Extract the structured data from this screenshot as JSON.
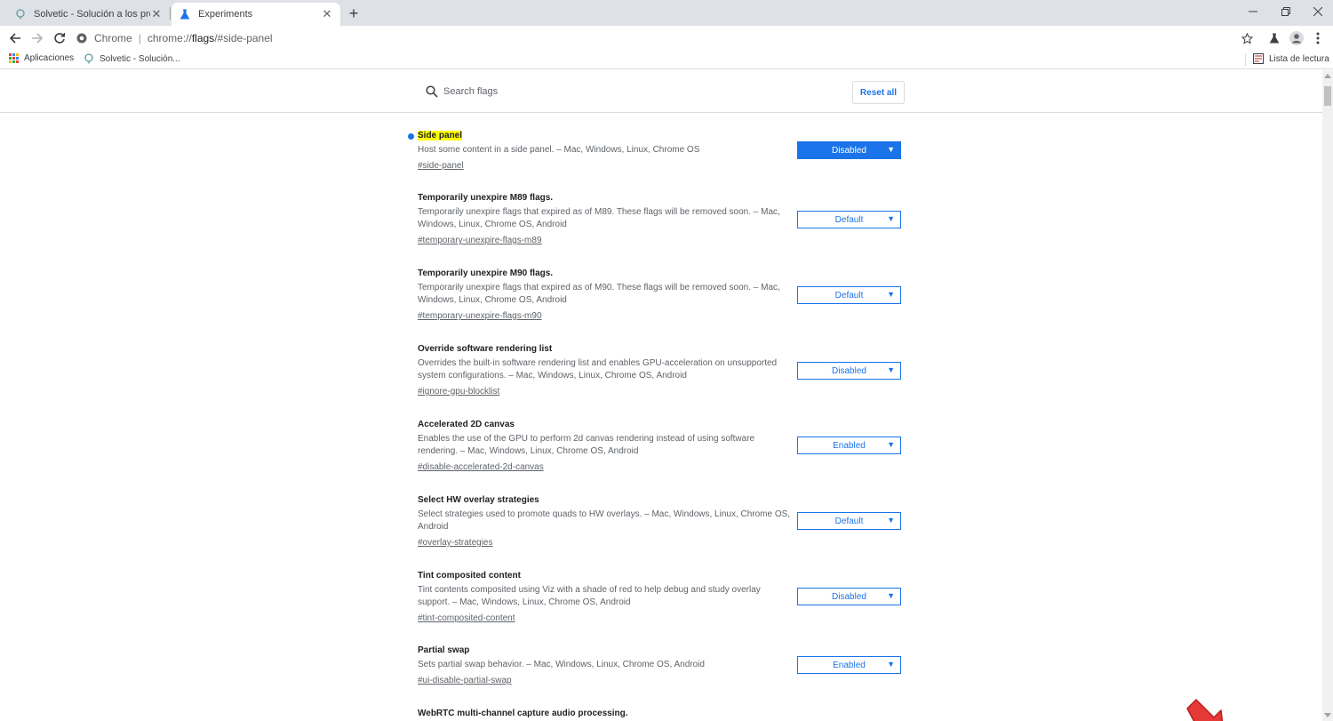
{
  "tabs": [
    {
      "title": "Solvetic - Solución a los problem",
      "icon": "solvetic-icon"
    },
    {
      "title": "Experiments",
      "icon": "flask-icon"
    }
  ],
  "omnibox": {
    "site": "Chrome",
    "url_prefix": "chrome://",
    "url_bold": "flags",
    "url_suffix": "/#side-panel"
  },
  "bookmarks": {
    "apps": "Aplicaciones",
    "solvetic": "Solvetic - Solución...",
    "reading_list": "Lista de lectura"
  },
  "search": {
    "placeholder": "Search flags",
    "reset": "Reset all"
  },
  "flags": [
    {
      "title": "Side panel",
      "highlight": true,
      "desc": "Host some content in a side panel. – Mac, Windows, Linux, Chrome OS",
      "hash": "#side-panel",
      "value": "Disabled",
      "modified": true
    },
    {
      "title": "Temporarily unexpire M89 flags.",
      "desc": "Temporarily unexpire flags that expired as of M89. These flags will be removed soon. – Mac, Windows, Linux, Chrome OS, Android",
      "hash": "#temporary-unexpire-flags-m89",
      "value": "Default"
    },
    {
      "title": "Temporarily unexpire M90 flags.",
      "desc": "Temporarily unexpire flags that expired as of M90. These flags will be removed soon. – Mac, Windows, Linux, Chrome OS, Android",
      "hash": "#temporary-unexpire-flags-m90",
      "value": "Default"
    },
    {
      "title": "Override software rendering list",
      "desc": "Overrides the built-in software rendering list and enables GPU-acceleration on unsupported system configurations. – Mac, Windows, Linux, Chrome OS, Android",
      "hash": "#ignore-gpu-blocklist",
      "value": "Disabled"
    },
    {
      "title": "Accelerated 2D canvas",
      "desc": "Enables the use of the GPU to perform 2d canvas rendering instead of using software rendering. – Mac, Windows, Linux, Chrome OS, Android",
      "hash": "#disable-accelerated-2d-canvas",
      "value": "Enabled"
    },
    {
      "title": "Select HW overlay strategies",
      "desc": "Select strategies used to promote quads to HW overlays. – Mac, Windows, Linux, Chrome OS, Android",
      "hash": "#overlay-strategies",
      "value": "Default"
    },
    {
      "title": "Tint composited content",
      "desc": "Tint contents composited using Viz with a shade of red to help debug and study overlay support. – Mac, Windows, Linux, Chrome OS, Android",
      "hash": "#tint-composited-content",
      "value": "Disabled"
    },
    {
      "title": "Partial swap",
      "desc": "Sets partial swap behavior. – Mac, Windows, Linux, Chrome OS, Android",
      "hash": "#ui-disable-partial-swap",
      "value": "Enabled"
    },
    {
      "title": "WebRTC multi-channel capture audio processing.",
      "desc": "",
      "hash": "",
      "value": ""
    }
  ],
  "colors": {
    "accent": "#1a73e8",
    "highlight": "#ffff00",
    "arrow": "#e53935"
  }
}
